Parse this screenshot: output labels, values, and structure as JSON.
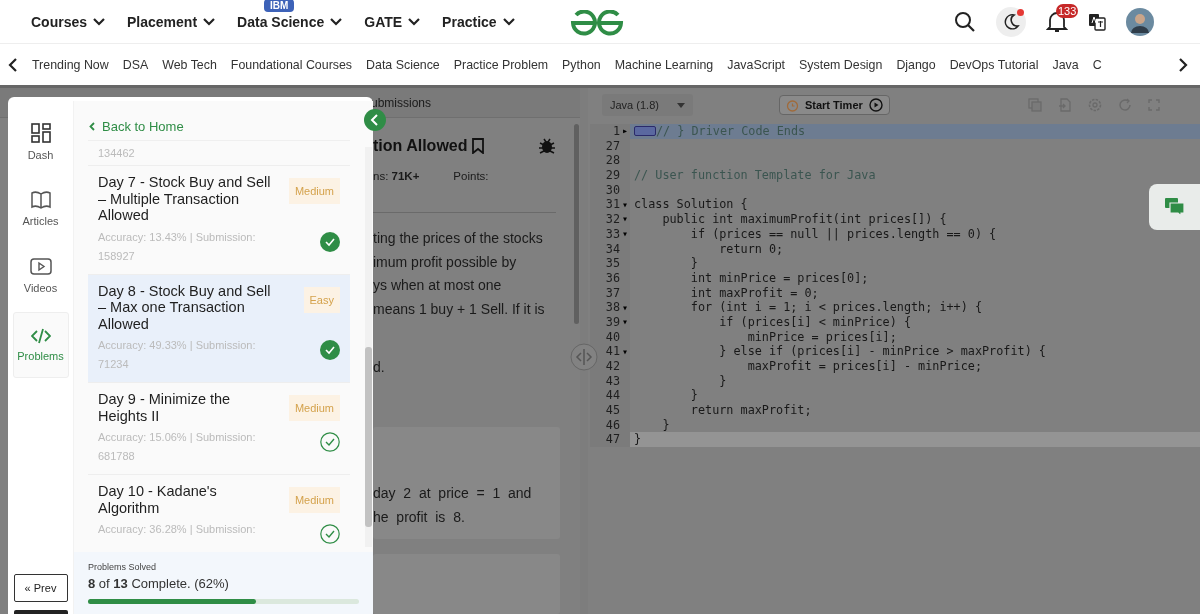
{
  "top_nav": {
    "menus": [
      {
        "label": "Courses"
      },
      {
        "label": "Placement"
      },
      {
        "label": "Data Science",
        "badge": "IBM"
      },
      {
        "label": "GATE"
      },
      {
        "label": "Practice"
      }
    ],
    "theme_dot": true,
    "notification_count": "133"
  },
  "sub_nav": {
    "items": [
      "Trending Now",
      "DSA",
      "Web Tech",
      "Foundational Courses",
      "Data Science",
      "Practice Problem",
      "Python",
      "Machine Learning",
      "JavaScript",
      "System Design",
      "Django",
      "DevOps Tutorial",
      "Java",
      "C"
    ]
  },
  "problem_pane": {
    "tab": "ubmissions",
    "title": "tion Allowed",
    "stats": [
      "ns: **71K+**",
      "Points:"
    ],
    "paragraph": [
      "ting the prices of the stocks",
      "imum profit possible by",
      "ys when at most one",
      "means 1 buy + 1 Sell. If it is"
    ],
    "tail": "d.",
    "example": [
      "day  2  at  price  =  1  and",
      "he  profit  is  8."
    ]
  },
  "editor": {
    "language": "Java (1.8)",
    "timer_button": "Start Timer",
    "lines": [
      {
        "no": "1",
        "text": "// } Driver Code Ends",
        "kind": "comment",
        "fold": "▸",
        "selected": true,
        "current": false
      },
      {
        "no": "27",
        "selected": false,
        "current": false
      },
      {
        "no": "28",
        "selected": false,
        "current": false
      },
      {
        "no": "29",
        "text": "// User function Template for Java",
        "kind": "comment",
        "selected": false,
        "current": false
      },
      {
        "no": "30",
        "selected": false,
        "current": false
      },
      {
        "no": "31",
        "text": "class Solution {",
        "kind": "code",
        "fold": "▾",
        "selected": false,
        "current": false
      },
      {
        "no": "32",
        "text": "    public int maximumProfit(int prices[]) {",
        "kind": "code",
        "fold": "▾",
        "selected": false,
        "current": false
      },
      {
        "no": "33",
        "text": "        if (prices == null || prices.length == 0) {",
        "kind": "code",
        "fold": "▾",
        "selected": false,
        "current": false
      },
      {
        "no": "34",
        "text": "            return 0;",
        "kind": "code",
        "selected": false,
        "current": false
      },
      {
        "no": "35",
        "text": "        }",
        "kind": "code",
        "selected": false,
        "current": false
      },
      {
        "no": "36",
        "text": "        int minPrice = prices[0];",
        "kind": "code",
        "selected": false,
        "current": false
      },
      {
        "no": "37",
        "text": "        int maxProfit = 0;",
        "kind": "code",
        "selected": false,
        "current": false
      },
      {
        "no": "38",
        "text": "        for (int i = 1; i < prices.length; i++) {",
        "kind": "code",
        "fold": "▾",
        "selected": false,
        "current": false
      },
      {
        "no": "39",
        "text": "            if (prices[i] < minPrice) {",
        "kind": "code",
        "fold": "▾",
        "selected": false,
        "current": false
      },
      {
        "no": "40",
        "text": "                minPrice = prices[i];",
        "kind": "code",
        "selected": false,
        "current": false
      },
      {
        "no": "41",
        "text": "            } else if (prices[i] - minPrice > maxProfit) {",
        "kind": "code",
        "fold": "▾",
        "selected": false,
        "current": false
      },
      {
        "no": "42",
        "text": "                maxProfit = prices[i] - minPrice;",
        "kind": "code",
        "selected": false,
        "current": false
      },
      {
        "no": "43",
        "text": "            }",
        "kind": "code",
        "selected": false,
        "current": false
      },
      {
        "no": "44",
        "text": "        }",
        "kind": "code",
        "selected": false,
        "current": false
      },
      {
        "no": "45",
        "text": "        return maxProfit;",
        "kind": "code",
        "selected": false,
        "current": false
      },
      {
        "no": "46",
        "text": "    }",
        "kind": "code",
        "selected": false,
        "current": false
      },
      {
        "no": "47",
        "text": "}",
        "kind": "code",
        "selected": false,
        "current": true
      }
    ]
  },
  "drawer": {
    "rail": [
      {
        "label": "Dash",
        "kind": "dash",
        "selected": false
      },
      {
        "label": "Articles",
        "kind": "articles",
        "selected": false
      },
      {
        "label": "Videos",
        "kind": "videos",
        "selected": false
      },
      {
        "label": "Problems",
        "kind": "problems",
        "selected": true
      }
    ],
    "prev_button": "« Prev",
    "back_link": "Back to Home",
    "cut_text": "134462",
    "problems": [
      {
        "title": "Day 7 - Stock Buy and Sell – Multiple Transaction Allowed",
        "difficulty": "Medium",
        "meta": "Accuracy: 13.43% | Submission: 158927",
        "completed": true,
        "selected": false
      },
      {
        "title": "Day 8 - Stock Buy and Sell – Max one Transaction Allowed",
        "difficulty": "Easy",
        "meta": "Accuracy: 49.33% | Submission: 71234",
        "completed": true,
        "selected": true
      },
      {
        "title": "Day 9 - Minimize the Heights II",
        "difficulty": "Medium",
        "meta": "Accuracy: 15.06% | Submission: 681788",
        "completed": false,
        "selected": false
      },
      {
        "title": "Day 10 - Kadane's Algorithm",
        "difficulty": "Medium",
        "meta": "Accuracy: 36.28% | Submission:",
        "completed": false,
        "selected": false
      }
    ],
    "summary": {
      "heading": "Problems Solved",
      "text": "**8** of **13** Complete. (62%)",
      "level": 0.62
    }
  }
}
